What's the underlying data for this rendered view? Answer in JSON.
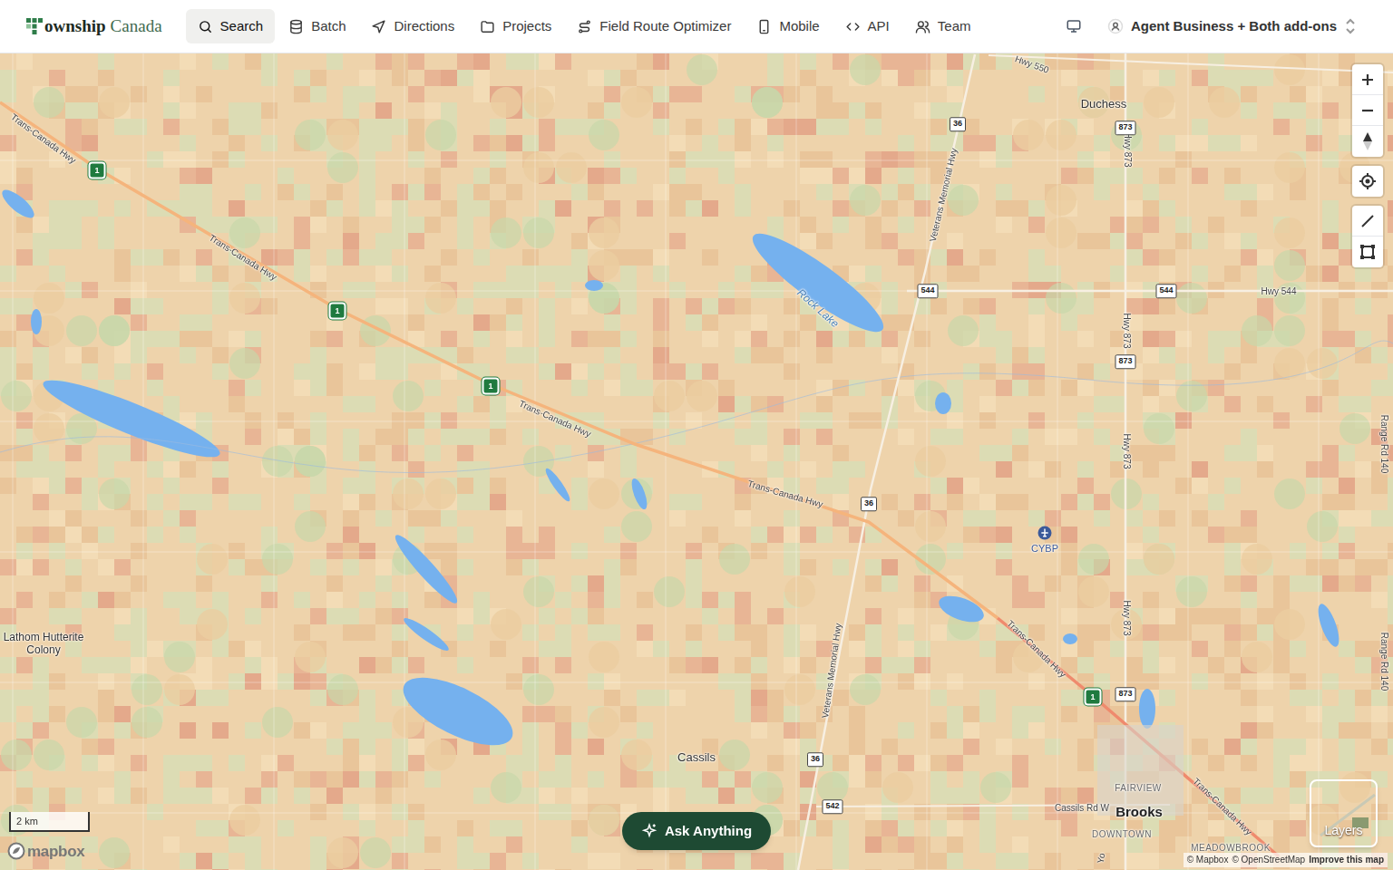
{
  "nav": {
    "logo": {
      "word": "ownship",
      "sub": "Canada"
    },
    "items": [
      {
        "label": "Search",
        "selected": true
      },
      {
        "label": "Batch",
        "selected": false
      },
      {
        "label": "Directions",
        "selected": false
      },
      {
        "label": "Projects",
        "selected": false
      },
      {
        "label": "Field Route Optimizer",
        "selected": false
      },
      {
        "label": "Mobile",
        "selected": false
      },
      {
        "label": "API",
        "selected": false
      },
      {
        "label": "Team",
        "selected": false
      }
    ],
    "account": "Agent Business + Both add-ons"
  },
  "map": {
    "labels": [
      {
        "text": "Duchess",
        "kind": "place"
      },
      {
        "text": "Rock Lake",
        "kind": "water"
      },
      {
        "text": "Cassils",
        "kind": "place"
      },
      {
        "text": "FAIRVIEW",
        "kind": "district"
      },
      {
        "text": "Brooks",
        "kind": "city"
      },
      {
        "text": "DOWNTOWN",
        "kind": "district"
      },
      {
        "text": "MEADOWBROOK",
        "kind": "district"
      },
      {
        "text": "CYBP",
        "kind": "airport"
      },
      {
        "text": "Lathom Hutterite Colony",
        "kind": "wrap"
      },
      {
        "text": "Trans-Canada Hwy",
        "kind": "road"
      },
      {
        "text": "Trans-Canada Hwy",
        "kind": "road"
      },
      {
        "text": "Trans-Canada Hwy",
        "kind": "road"
      },
      {
        "text": "Trans-Canada Hwy",
        "kind": "road"
      },
      {
        "text": "Trans-Canada Hwy",
        "kind": "road"
      },
      {
        "text": "Trans-Canada Hwy",
        "kind": "road"
      },
      {
        "text": "Hwy 550",
        "kind": "road"
      },
      {
        "text": "Veterans Memorial Hwy",
        "kind": "road"
      },
      {
        "text": "Veterans Memorial Hwy",
        "kind": "road"
      },
      {
        "text": "Hwy 873",
        "kind": "road"
      },
      {
        "text": "Hwy 873",
        "kind": "road"
      },
      {
        "text": "Hwy 873",
        "kind": "road"
      },
      {
        "text": "Hwy 873",
        "kind": "road"
      },
      {
        "text": "Hwy 544",
        "kind": "road"
      },
      {
        "text": "Range Rd 140",
        "kind": "road"
      },
      {
        "text": "Range Rd 140",
        "kind": "road"
      },
      {
        "text": "Cassils Rd W",
        "kind": "road"
      },
      {
        "text": "Yo",
        "kind": "road"
      },
      {
        "text": "1",
        "kind": "tch"
      },
      {
        "text": "1",
        "kind": "tch"
      },
      {
        "text": "1",
        "kind": "tch"
      },
      {
        "text": "1",
        "kind": "tch"
      },
      {
        "text": "36",
        "kind": "shield"
      },
      {
        "text": "36",
        "kind": "shield"
      },
      {
        "text": "36",
        "kind": "shield"
      },
      {
        "text": "873",
        "kind": "shield"
      },
      {
        "text": "873",
        "kind": "shield"
      },
      {
        "text": "873",
        "kind": "shield"
      },
      {
        "text": "544",
        "kind": "shield"
      },
      {
        "text": "544",
        "kind": "shield"
      },
      {
        "text": "542",
        "kind": "shield"
      }
    ]
  },
  "scale": "2 km",
  "brand": "mapbox",
  "attribution": [
    "© Mapbox",
    "© OpenStreetMap",
    "Improve this map"
  ],
  "layers": "Layers",
  "ask": "Ask Anything"
}
